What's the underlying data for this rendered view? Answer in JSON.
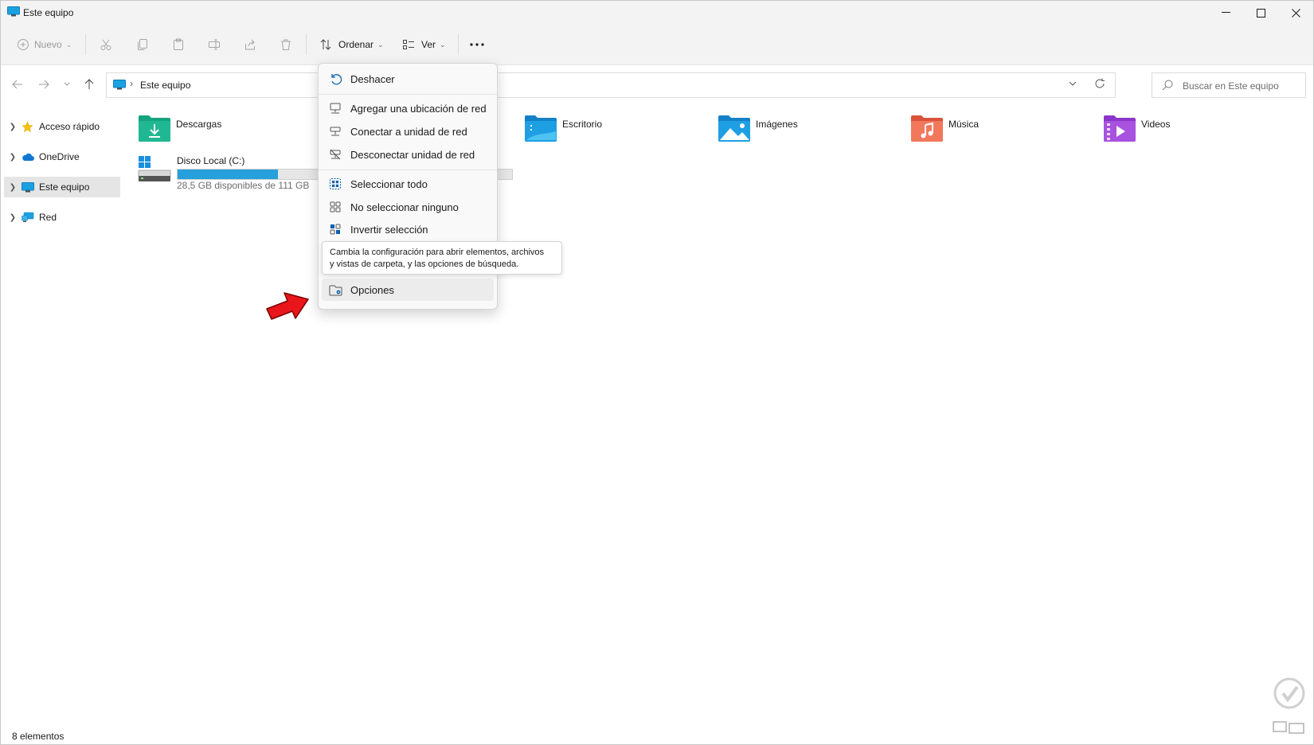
{
  "window": {
    "title": "Este equipo"
  },
  "toolbar": {
    "new_label": "Nuevo",
    "sort_label": "Ordenar",
    "view_label": "Ver"
  },
  "address": {
    "crumb": "Este equipo",
    "search_placeholder": "Buscar en Este equipo"
  },
  "sidebar": {
    "items": [
      {
        "label": "Acceso rápido",
        "icon": "star-icon"
      },
      {
        "label": "OneDrive",
        "icon": "cloud-icon"
      },
      {
        "label": "Este equipo",
        "icon": "computer-icon"
      },
      {
        "label": "Red",
        "icon": "network-icon"
      }
    ]
  },
  "folders": [
    {
      "name": "Descargas",
      "icon": "downloads-folder-icon"
    },
    {
      "name": "Escritorio",
      "icon": "desktop-folder-icon"
    },
    {
      "name": "Imágenes",
      "icon": "pictures-folder-icon"
    },
    {
      "name": "Música",
      "icon": "music-folder-icon"
    },
    {
      "name": "Videos",
      "icon": "videos-folder-icon"
    }
  ],
  "drive": {
    "name": "Disco Local (C:)",
    "free": "28,5 GB disponibles de 111 GB",
    "used_fraction": 0.3
  },
  "menu": {
    "items": [
      {
        "label": "Deshacer",
        "icon": "undo-icon"
      },
      {
        "label": "Agregar una ubicación de red",
        "icon": "network-location-icon"
      },
      {
        "label": "Conectar a unidad de red",
        "icon": "map-drive-icon"
      },
      {
        "label": "Desconectar unidad de red",
        "icon": "disconnect-drive-icon"
      },
      {
        "label": "Seleccionar todo",
        "icon": "select-all-icon"
      },
      {
        "label": "No seleccionar ninguno",
        "icon": "select-none-icon"
      },
      {
        "label": "Invertir selección",
        "icon": "invert-selection-icon"
      },
      {
        "label": "Opciones",
        "icon": "folder-options-icon"
      }
    ]
  },
  "tooltip": {
    "line1": "Cambia la configuración para abrir elementos, archivos",
    "line2": "y vistas de carpeta, y las opciones de búsqueda."
  },
  "status": {
    "count": "8 elementos"
  },
  "colors": {
    "accent": "#26a0da",
    "pointer": "#e8161b"
  }
}
